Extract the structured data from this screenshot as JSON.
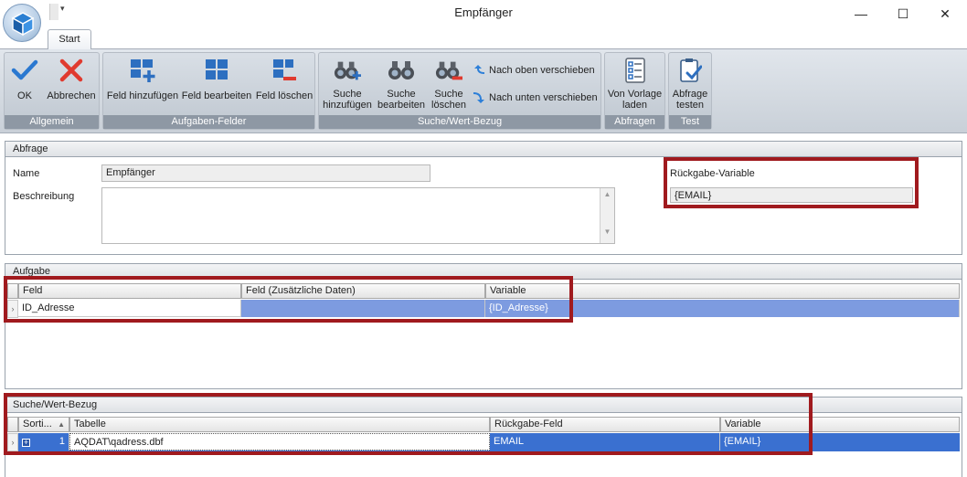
{
  "window": {
    "title": "Empfänger",
    "qat_arrow": "▾",
    "minimize": "—",
    "maximize": "☐",
    "close": "✕"
  },
  "tabs": [
    {
      "label": "Start"
    }
  ],
  "ribbon": {
    "groups": [
      {
        "label": "Allgemein",
        "buttons": [
          {
            "label": "OK",
            "icon": "checkmark-icon"
          },
          {
            "label": "Abbrechen",
            "icon": "cross-icon"
          }
        ]
      },
      {
        "label": "Aufgaben-Felder",
        "buttons": [
          {
            "label": "Feld hinzufügen"
          },
          {
            "label": "Feld bearbeiten"
          },
          {
            "label": "Feld löschen"
          }
        ]
      },
      {
        "label": "Suche/Wert-Bezug",
        "buttons": [
          {
            "label_1": "Suche",
            "label_2": "hinzufügen"
          },
          {
            "label_1": "Suche",
            "label_2": "bearbeiten"
          },
          {
            "label_1": "Suche",
            "label_2": "löschen"
          }
        ],
        "small_buttons": [
          {
            "label": "Nach oben verschieben"
          },
          {
            "label": "Nach unten verschieben"
          }
        ]
      },
      {
        "label": "Abfragen",
        "buttons": [
          {
            "label_1": "Von Vorlage",
            "label_2": "laden"
          }
        ]
      },
      {
        "label": "Test",
        "buttons": [
          {
            "label_1": "Abfrage",
            "label_2": "testen"
          }
        ]
      }
    ]
  },
  "abfrage": {
    "header": "Abfrage",
    "name_label": "Name",
    "name_value": "Empfänger",
    "beschreibung_label": "Beschreibung",
    "beschreibung_value": "",
    "rueckgabe_label": "Rückgabe-Variable",
    "rueckgabe_value": "{EMAIL}"
  },
  "aufgabe": {
    "header": "Aufgabe",
    "columns": [
      "Feld",
      "Feld (Zusätzliche Daten)",
      "Variable"
    ],
    "rows": [
      {
        "feld": "ID_Adresse",
        "zusatz": "",
        "variable": "{ID_Adresse}"
      }
    ]
  },
  "suche": {
    "header": "Suche/Wert-Bezug",
    "columns": [
      "Sorti...",
      "Tabelle",
      "Rückgabe-Feld",
      "Variable"
    ],
    "rows": [
      {
        "expand": "+",
        "sort": "1",
        "tabelle": "AQDAT\\qadress.dbf",
        "feld": "EMAIL",
        "variable": "{EMAIL}"
      }
    ]
  },
  "colors": {
    "accent_red": "#a01a1e",
    "selection_blue": "#3a70d0",
    "selection_light": "#7d9be0"
  }
}
